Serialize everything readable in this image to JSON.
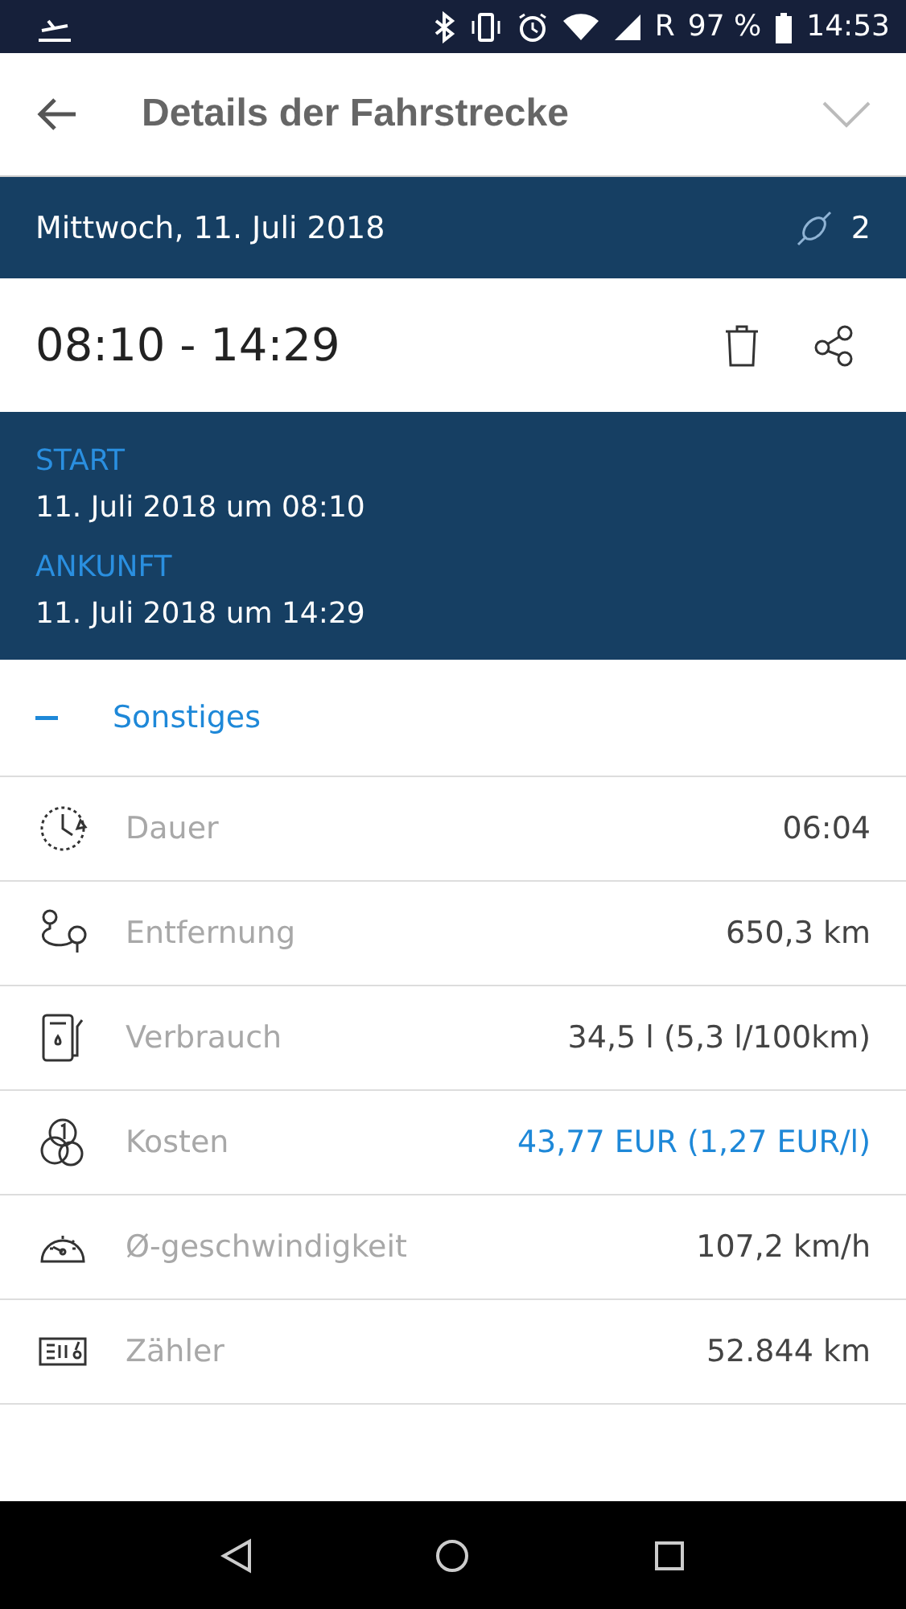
{
  "status_bar": {
    "roaming": "R",
    "battery": "97 %",
    "time": "14:53"
  },
  "app_bar": {
    "title": "Details der Fahrstrecke"
  },
  "date_bar": {
    "date": "Mittwoch, 11. Juli 2018",
    "count": "2"
  },
  "trip": {
    "time_range": "08:10 - 14:29"
  },
  "stops": [
    {
      "label": "START",
      "value": "11. Juli 2018 um 08:10"
    },
    {
      "label": "ANKUNFT",
      "value": "11. Juli 2018 um 14:29"
    }
  ],
  "section": {
    "title": "Sonstiges",
    "expanded": true
  },
  "rows": [
    {
      "label": "Dauer",
      "value": "06:04",
      "kind": "plain"
    },
    {
      "label": "Entfernung",
      "value": "650,3 km",
      "kind": "plain"
    },
    {
      "label": "Verbrauch",
      "value": "34,5 l (5,3 l/100km)",
      "kind": "plain"
    },
    {
      "label": "Kosten",
      "value": "43,77 EUR (1,27 EUR/l)",
      "kind": "link"
    },
    {
      "label": "Ø-geschwindigkeit",
      "value": "107,2 km/h",
      "kind": "plain"
    },
    {
      "label": "Zähler",
      "value": "52.844 km",
      "kind": "plain"
    }
  ]
}
